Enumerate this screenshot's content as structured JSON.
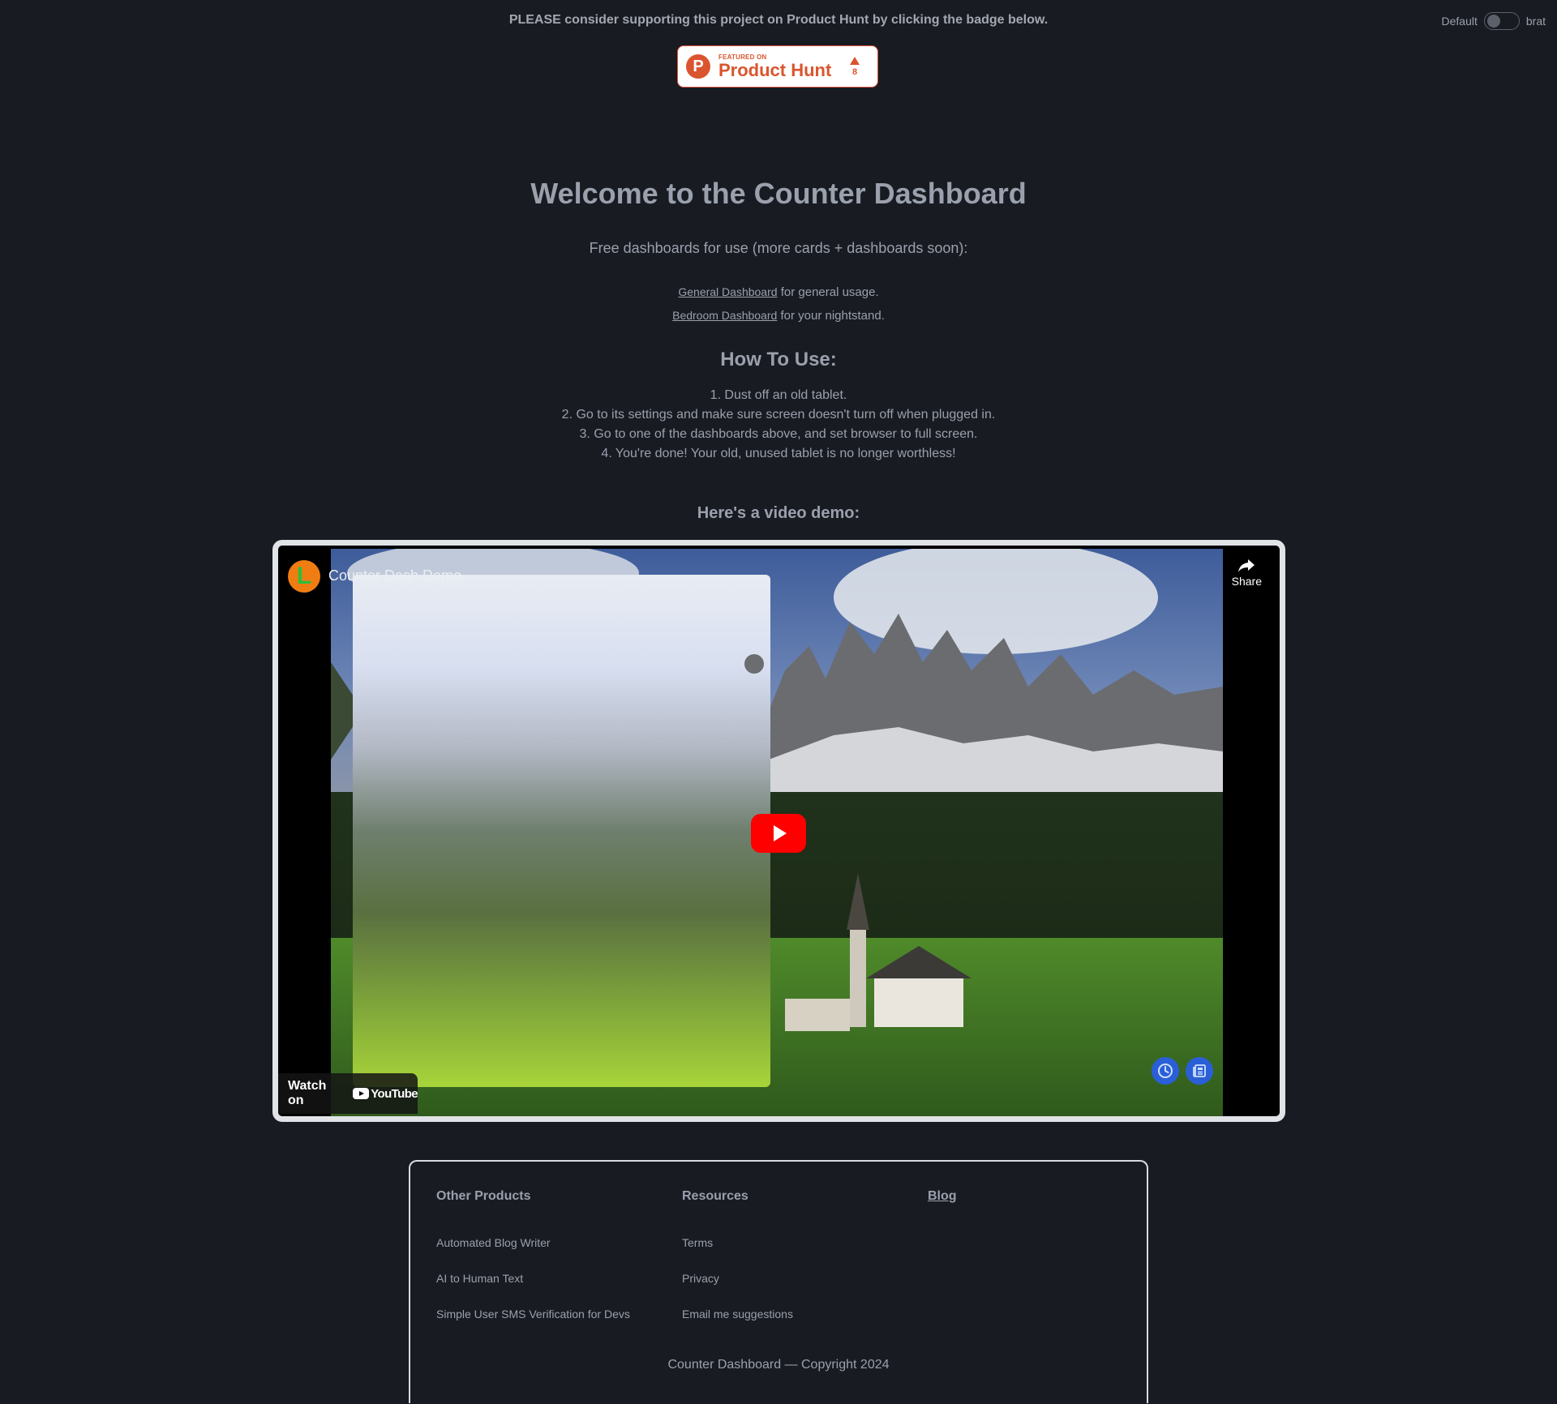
{
  "promo": {
    "message": "PLEASE consider supporting this project on Product Hunt by clicking the badge below."
  },
  "product_hunt_badge": {
    "logo_letter": "P",
    "featured_label": "FEATURED ON",
    "name": "Product Hunt",
    "upvotes": "8",
    "brand_color": "#da552f"
  },
  "theme_toggle": {
    "left_label": "Default",
    "right_label": "brat",
    "state": "off"
  },
  "hero": {
    "title": "Welcome to the Counter Dashboard",
    "subtitle": "Free dashboards for use (more cards + dashboards soon):",
    "dashboards": [
      {
        "link_text": "General Dashboard",
        "suffix": " for general usage."
      },
      {
        "link_text": "Bedroom Dashboard",
        "suffix": " for your nightstand."
      }
    ]
  },
  "how_to": {
    "heading": "How To Use:",
    "steps": [
      "1. Dust off an old tablet.",
      "2. Go to its settings and make sure screen doesn't turn off when plugged in.",
      "3. Go to one of the dashboards above, and set browser to full screen.",
      "4. You're done! Your old, unused tablet is no longer worthless!"
    ]
  },
  "video": {
    "heading": "Here's a video demo:",
    "title": "Counter Dash Demo",
    "channel_avatar_letter": "L",
    "share_label": "Share",
    "watch_on_label": "Watch on",
    "youtube_label": "YouTube",
    "play_color": "#ff0000",
    "action_buttons": [
      "clock-icon",
      "newspaper-icon"
    ]
  },
  "footer": {
    "columns": [
      {
        "heading": "Other Products",
        "is_link": false,
        "items": [
          "Automated Blog Writer",
          "AI to Human Text",
          "Simple User SMS Verification for Devs"
        ]
      },
      {
        "heading": "Resources",
        "is_link": false,
        "items": [
          "Terms",
          "Privacy",
          "Email me suggestions"
        ]
      },
      {
        "heading": "Blog",
        "is_link": true,
        "items": []
      }
    ],
    "copyright": "Counter Dashboard — Copyright 2024"
  }
}
